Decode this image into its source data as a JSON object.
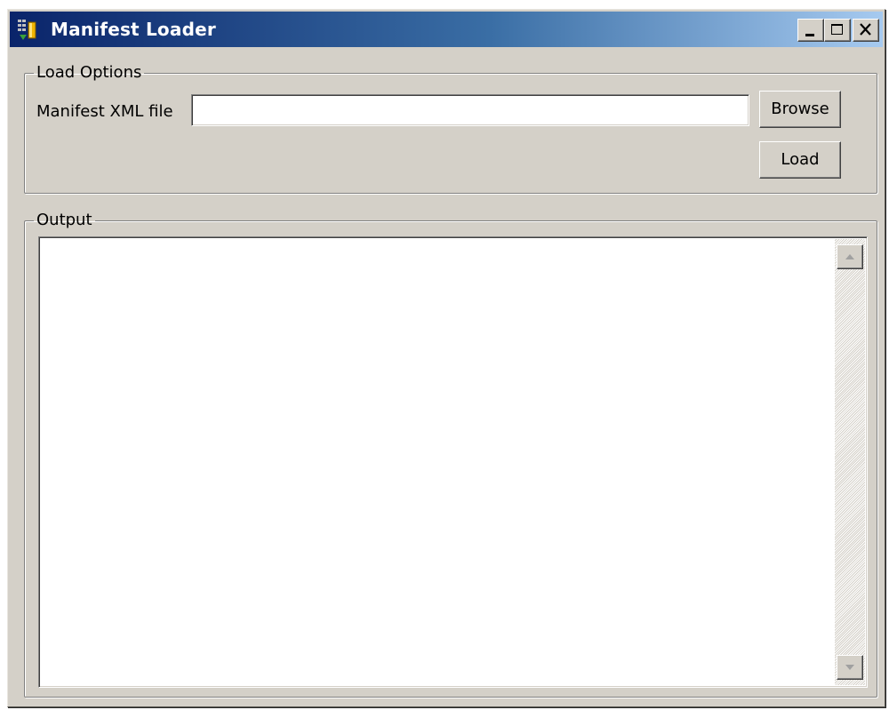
{
  "window": {
    "title": "Manifest Loader"
  },
  "load_options": {
    "legend": "Load Options",
    "file_label": "Manifest XML file",
    "file_value": "",
    "browse_label": "Browse",
    "load_label": "Load"
  },
  "output": {
    "legend": "Output",
    "text": ""
  },
  "icons": {
    "app": "manifest-app-icon",
    "minimize": "minimize-icon",
    "maximize": "maximize-icon",
    "close": "close-icon",
    "scroll_up": "scroll-up-arrow-icon",
    "scroll_down": "scroll-down-arrow-icon"
  },
  "colors": {
    "titlebar_start": "#0a246a",
    "titlebar_end": "#a6caf0",
    "face": "#d4d0c8"
  }
}
